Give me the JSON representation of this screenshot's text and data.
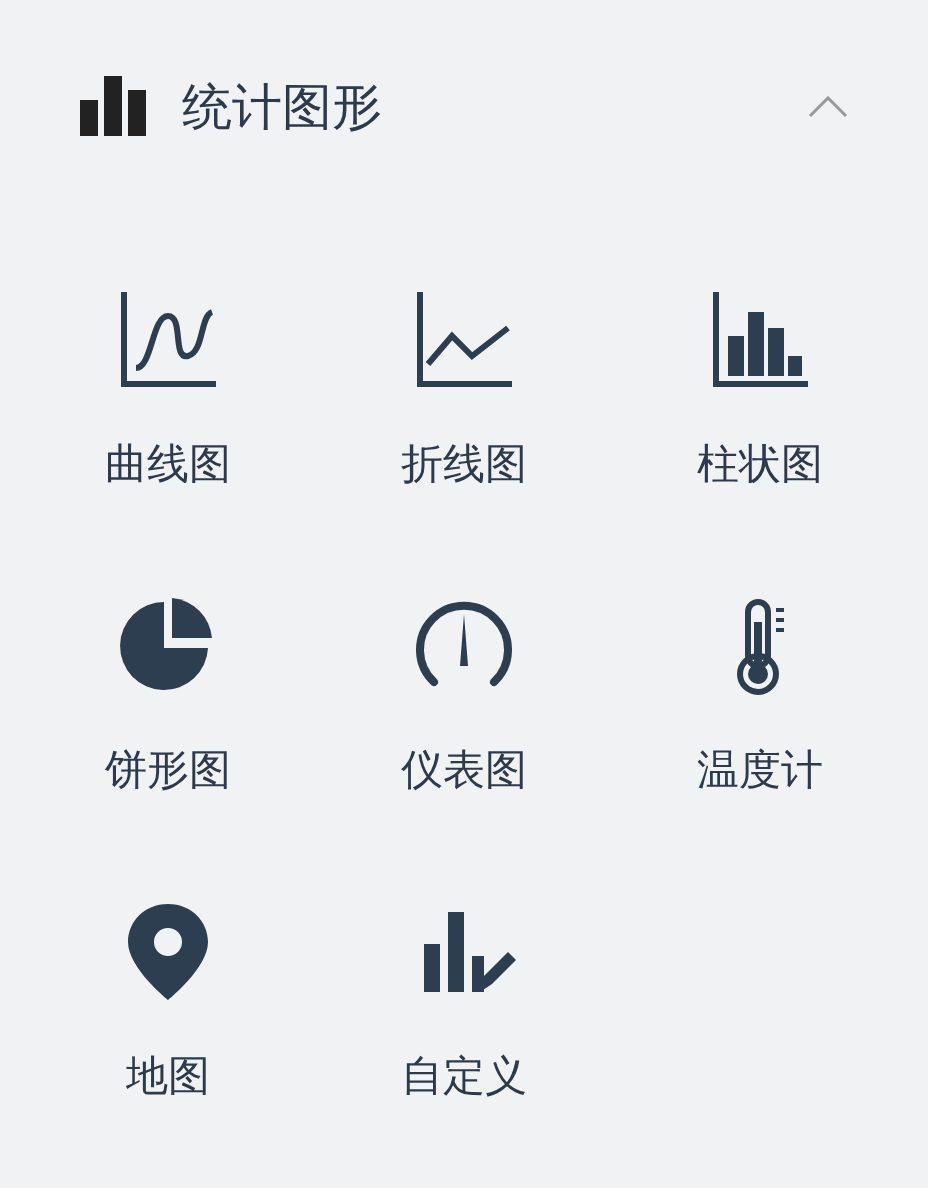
{
  "panel": {
    "title": "统计图形",
    "expanded": true
  },
  "items": [
    {
      "label": "曲线图",
      "kind": "curve"
    },
    {
      "label": "折线图",
      "kind": "line"
    },
    {
      "label": "柱状图",
      "kind": "bar"
    },
    {
      "label": "饼形图",
      "kind": "pie"
    },
    {
      "label": "仪表图",
      "kind": "gauge"
    },
    {
      "label": "温度计",
      "kind": "thermometer"
    },
    {
      "label": "地图",
      "kind": "map"
    },
    {
      "label": "自定义",
      "kind": "custom"
    }
  ]
}
